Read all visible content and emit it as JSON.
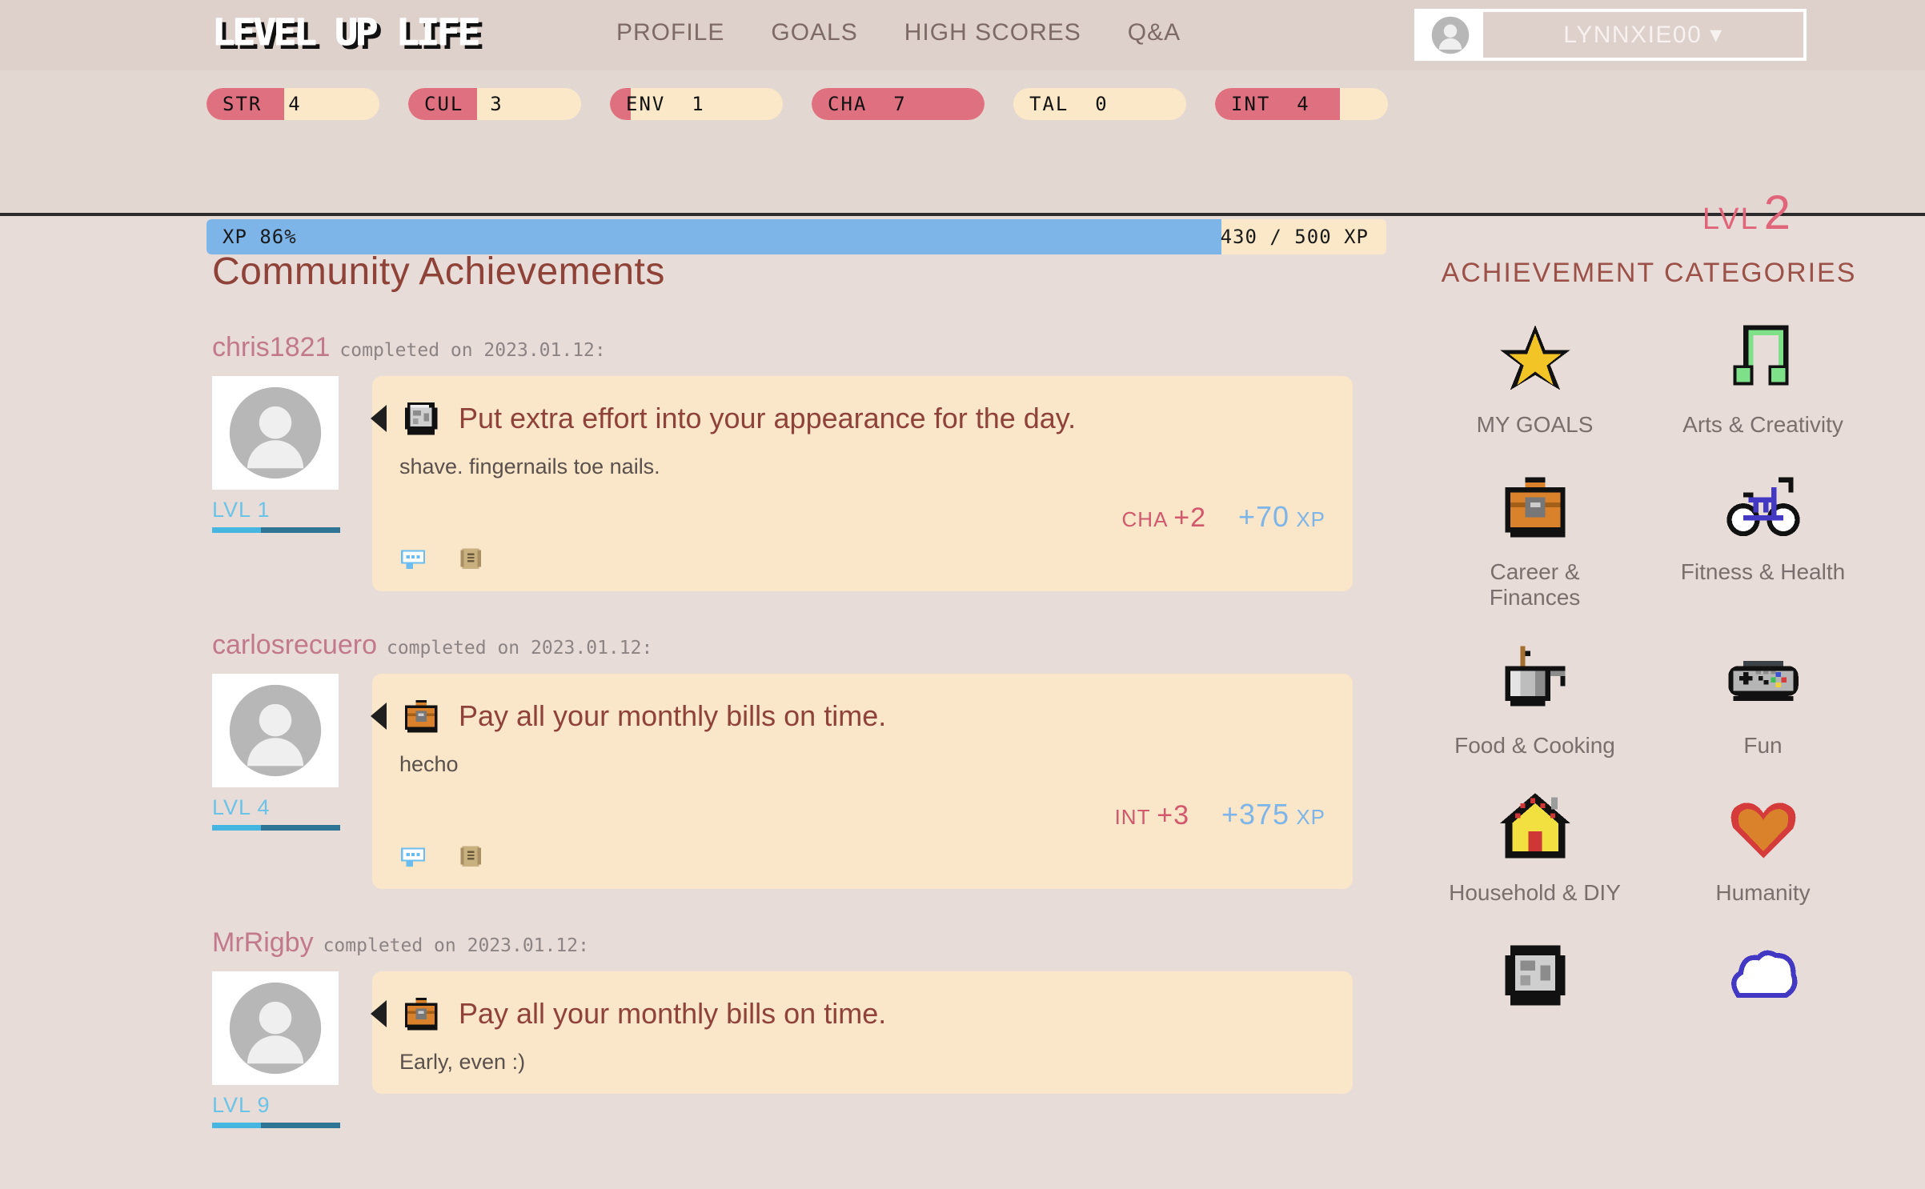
{
  "header": {
    "logo": "LEVEL UP LIFE",
    "nav": [
      {
        "label": "PROFILE"
      },
      {
        "label": "GOALS"
      },
      {
        "label": "HIGH SCORES"
      },
      {
        "label": "Q&A"
      }
    ],
    "user": {
      "name": "LYNNXIE00 ▾",
      "avatar_icon": "user-avatar-icon"
    }
  },
  "stats": {
    "pills": [
      {
        "code": "STR",
        "value": "4",
        "pct": 45
      },
      {
        "code": "CUL",
        "value": "3",
        "pct": 40
      },
      {
        "code": "ENV",
        "value": "1",
        "pct": 12
      },
      {
        "code": "CHA",
        "value": "7",
        "pct": 100
      },
      {
        "code": "TAL",
        "value": "0",
        "pct": 0
      },
      {
        "code": "INT",
        "value": "4",
        "pct": 72
      }
    ],
    "xp": {
      "label": "XP 86%",
      "count": "430 / 500 XP",
      "percent": 86
    },
    "level": {
      "label": "LVL",
      "value": "2"
    },
    "colors": {
      "fill": "#de7080",
      "track": "#fae8c8",
      "xp_fill": "#7db5e8"
    }
  },
  "feed": {
    "title": "Community Achievements",
    "posts": [
      {
        "user": "chris1821",
        "meta": "completed on 2023.01.12:",
        "level_tag": "LVL 1",
        "level_pct": 38,
        "icon": "mirror-icon",
        "achievement": "Put extra effort into your appearance for the day.",
        "note": "shave. fingernails toe nails.",
        "stat_code": "CHA",
        "stat_delta": "+2",
        "xp_delta": "+70",
        "xp_suffix": "XP",
        "actions": [
          "comment-icon",
          "scroll-icon"
        ]
      },
      {
        "user": "carlosrecuero",
        "meta": "completed on 2023.01.12:",
        "level_tag": "LVL 4",
        "level_pct": 38,
        "icon": "briefcase-icon",
        "achievement": "Pay all your monthly bills on time.",
        "note": "hecho",
        "stat_code": "INT",
        "stat_delta": "+3",
        "xp_delta": "+375",
        "xp_suffix": "XP",
        "actions": [
          "comment-icon",
          "scroll-icon"
        ]
      },
      {
        "user": "MrRigby",
        "meta": "completed on 2023.01.12:",
        "level_tag": "LVL 9",
        "level_pct": 38,
        "icon": "briefcase-icon",
        "achievement": "Pay all your monthly bills on time.",
        "note": "Early, even :)",
        "stat_code": "",
        "stat_delta": "",
        "xp_delta": "",
        "xp_suffix": "",
        "actions": []
      }
    ]
  },
  "sidebar": {
    "title": "ACHIEVEMENT CATEGORIES",
    "categories": [
      {
        "label": "MY GOALS",
        "icon": "star-icon"
      },
      {
        "label": "Arts & Creativity",
        "icon": "music-note-icon"
      },
      {
        "label": "Career & Finances",
        "icon": "briefcase-icon"
      },
      {
        "label": "Fitness & Health",
        "icon": "bicycle-icon"
      },
      {
        "label": "Food & Cooking",
        "icon": "pot-icon"
      },
      {
        "label": "Fun",
        "icon": "gamepad-icon"
      },
      {
        "label": "Household & DIY",
        "icon": "house-icon"
      },
      {
        "label": "Humanity",
        "icon": "heart-icon"
      },
      {
        "label": "",
        "icon": "mirror-icon"
      },
      {
        "label": "",
        "icon": "cloud-icon"
      }
    ]
  },
  "colors": {
    "page_bg": "#e7dcd8",
    "header_bg": "#ded0cb",
    "card_bg": "#fae6c9",
    "title": "#8f4238",
    "accent_pink": "#c2798b",
    "accent_blue": "#7db5e8"
  }
}
